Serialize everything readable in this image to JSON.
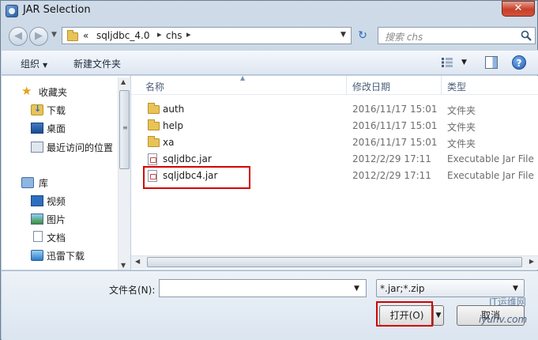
{
  "window": {
    "title": "JAR Selection",
    "close_symbol": "✕"
  },
  "address": {
    "chevrons": "«",
    "path": [
      "sqljdbc_4.0",
      "chs"
    ],
    "separator": "▸"
  },
  "search": {
    "placeholder": "搜索 chs"
  },
  "toolbar": {
    "organize_label": "组织",
    "new_folder_label": "新建文件夹"
  },
  "nav": {
    "favorites": {
      "label": "收藏夹",
      "items": [
        "下载",
        "桌面",
        "最近访问的位置"
      ]
    },
    "libraries": {
      "label": "库",
      "items": [
        "视频",
        "图片",
        "文档",
        "迅雷下载"
      ]
    }
  },
  "columns": {
    "name": "名称",
    "date": "修改日期",
    "type": "类型"
  },
  "files": [
    {
      "name": "auth",
      "date": "2016/11/17 15:01",
      "type": "文件夹",
      "kind": "folder"
    },
    {
      "name": "help",
      "date": "2016/11/17 15:01",
      "type": "文件夹",
      "kind": "folder"
    },
    {
      "name": "xa",
      "date": "2016/11/17 15:01",
      "type": "文件夹",
      "kind": "folder"
    },
    {
      "name": "sqljdbc.jar",
      "date": "2012/2/29 17:11",
      "type": "Executable Jar File",
      "kind": "jar"
    },
    {
      "name": "sqljdbc4.jar",
      "date": "2012/2/29 17:11",
      "type": "Executable Jar File",
      "kind": "jar"
    }
  ],
  "filename": {
    "label": "文件名(N):",
    "value": ""
  },
  "filter": {
    "value": "*.jar;*.zip"
  },
  "buttons": {
    "open": "打开(O)",
    "cancel": "取消"
  },
  "watermark": {
    "text": "iyunv.com",
    "brand": "IT运维网"
  },
  "colors": {
    "highlight": "#d40000",
    "accent": "#2a6cc0"
  }
}
